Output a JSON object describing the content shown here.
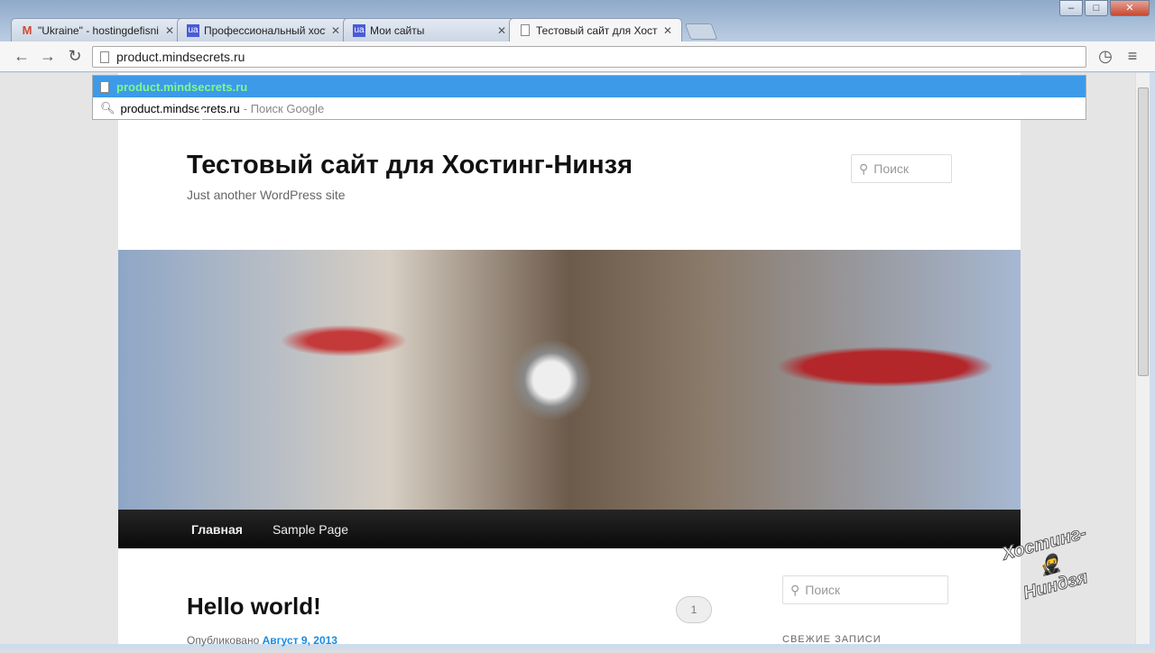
{
  "browser": {
    "tabs": [
      {
        "icon": "M",
        "label": "\"Ukraine\" - hostingdefisni",
        "icon_color": "#d14836"
      },
      {
        "icon": "ua",
        "label": "Профессиональный хостинг",
        "icon_color": "#4a5bd6"
      },
      {
        "icon": "ua",
        "label": "Мои сайты",
        "icon_color": "#4a5bd6"
      },
      {
        "icon": "doc",
        "label": "Тестовый сайт для Хостинг"
      }
    ],
    "address": "product.mindsecrets.ru",
    "suggestions": [
      {
        "text": "product.mindsecrets.ru",
        "suffix": ""
      },
      {
        "text": "product.mindsecrets.ru",
        "suffix": "- Поиск Google"
      }
    ]
  },
  "site": {
    "title": "Тестовый сайт для Хостинг-Нинзя",
    "description": "Just another WordPress site",
    "search_placeholder": "Поиск",
    "menu": [
      "Главная",
      "Sample Page"
    ],
    "post_title": "Hello world!",
    "comments": "1",
    "published_label": "Опубликовано",
    "published_date": "Август 9, 2013",
    "sidebar_search_placeholder": "Поиск",
    "recent_heading": "СВЕЖИЕ ЗАПИСИ"
  },
  "watermark": "Хостинг-Ниндзя"
}
